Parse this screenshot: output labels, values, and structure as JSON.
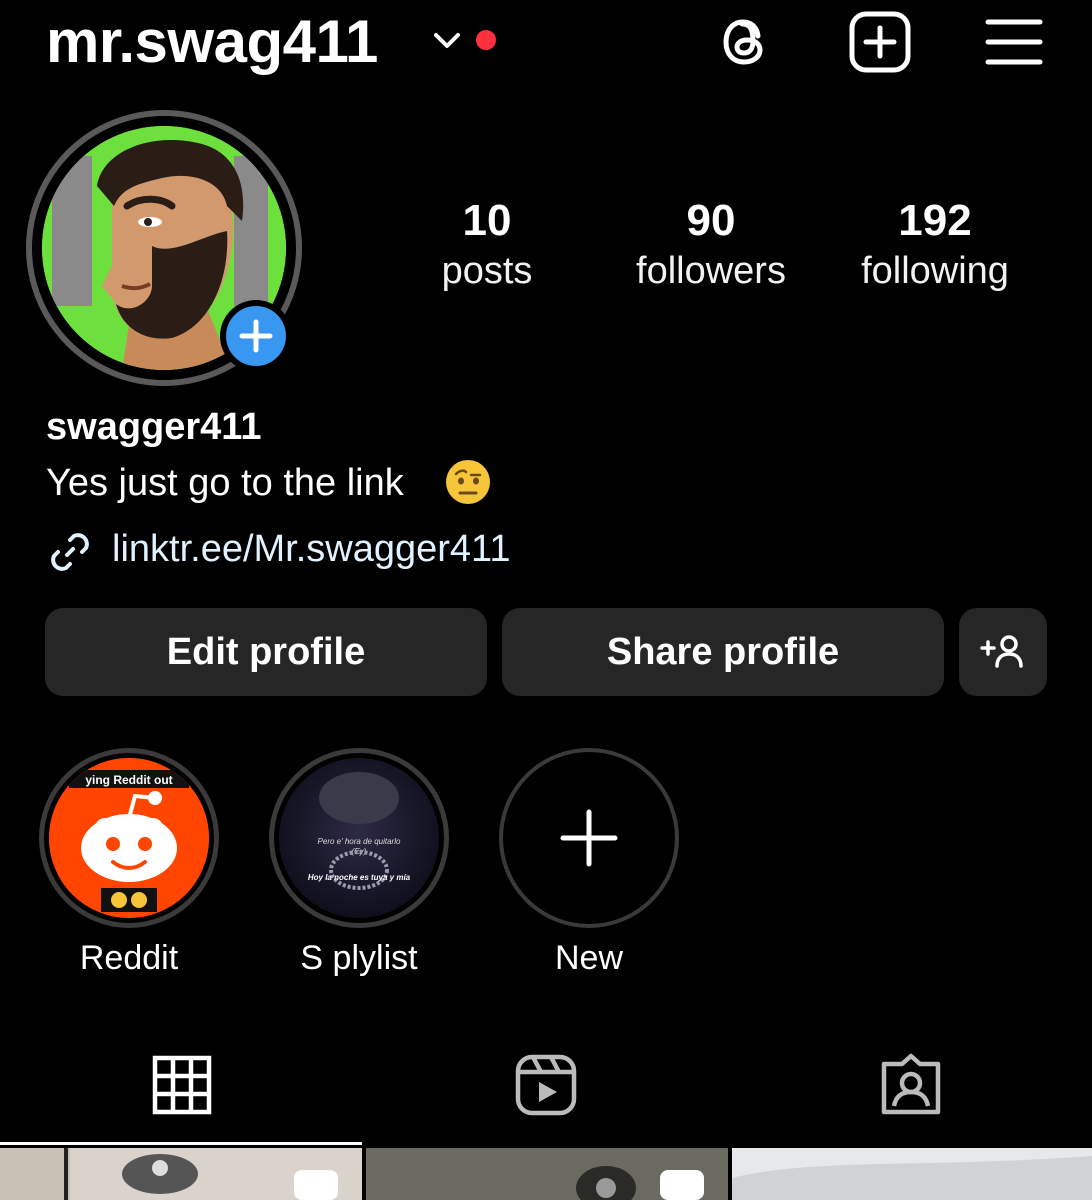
{
  "header": {
    "username": "mr.swag411",
    "icons": [
      "chevron-down-icon",
      "threads-icon",
      "plus-square-icon",
      "menu-icon"
    ],
    "notification_dot_color": "#ff3040"
  },
  "stats": [
    {
      "value": "10",
      "label": "posts"
    },
    {
      "value": "90",
      "label": "followers"
    },
    {
      "value": "192",
      "label": "following"
    }
  ],
  "profile": {
    "name": "swagger411",
    "bio": "Yes just go to the link",
    "bio_emoji": "raised-eyebrow-emoji",
    "link": "linktr.ee/Mr.swagger411",
    "avatar_bg_color": "#6ee03d"
  },
  "buttons": {
    "edit": "Edit profile",
    "share": "Share profile",
    "add_user_icon": "add-user-icon"
  },
  "highlights": [
    {
      "label": "Reddit",
      "overlay_text": "ying Reddit out",
      "icon": "reddit-icon"
    },
    {
      "label": "S plylist",
      "overlay_text_1": "Pero e' hora de quitarlo",
      "overlay_text_2": "(Ey)",
      "overlay_text_3": "Hoy la noche es tuya y mía"
    },
    {
      "label": "New",
      "icon": "plus-icon"
    }
  ],
  "tabs": [
    "grid-icon",
    "reels-icon",
    "tagged-icon"
  ],
  "colors": {
    "accent_blue": "#3897f0",
    "button_bg": "#262626",
    "reddit_orange": "#ff4500"
  }
}
